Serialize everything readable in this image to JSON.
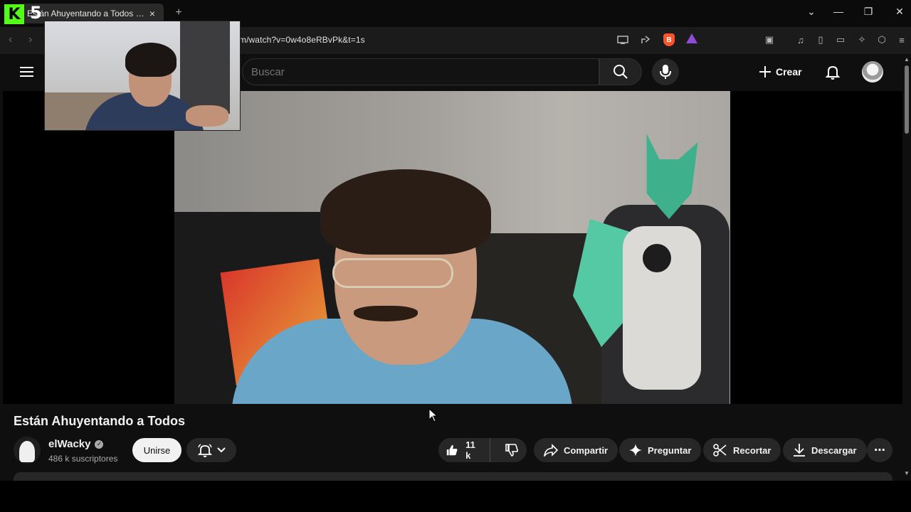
{
  "browser": {
    "tab_title": "Están Ahuyentando a Todos - YouTube",
    "tab_close": "×",
    "new_tab": "+",
    "url": "m/watch?v=0w4o8eRBvPk&t=1s",
    "window_controls": [
      "⌄",
      "—",
      "❐",
      "✕"
    ]
  },
  "overlay": {
    "kick_logo": "K",
    "kick_number": "5"
  },
  "masthead": {
    "search_placeholder": "Buscar",
    "create_label": "Crear"
  },
  "video": {
    "title": "Están Ahuyentando a Todos"
  },
  "channel": {
    "name": "elWacky",
    "subscribers": "486 k suscriptores",
    "join_label": "Unirse"
  },
  "actions": {
    "likes": "11 k",
    "share": "Compartir",
    "ask": "Preguntar",
    "clip": "Recortar",
    "download": "Descargar",
    "more": "⋯"
  },
  "colors": {
    "background": "#0f0f0f",
    "pill": "#272727",
    "kick_green": "#53fc18",
    "brave_orange": "#fb542b"
  }
}
